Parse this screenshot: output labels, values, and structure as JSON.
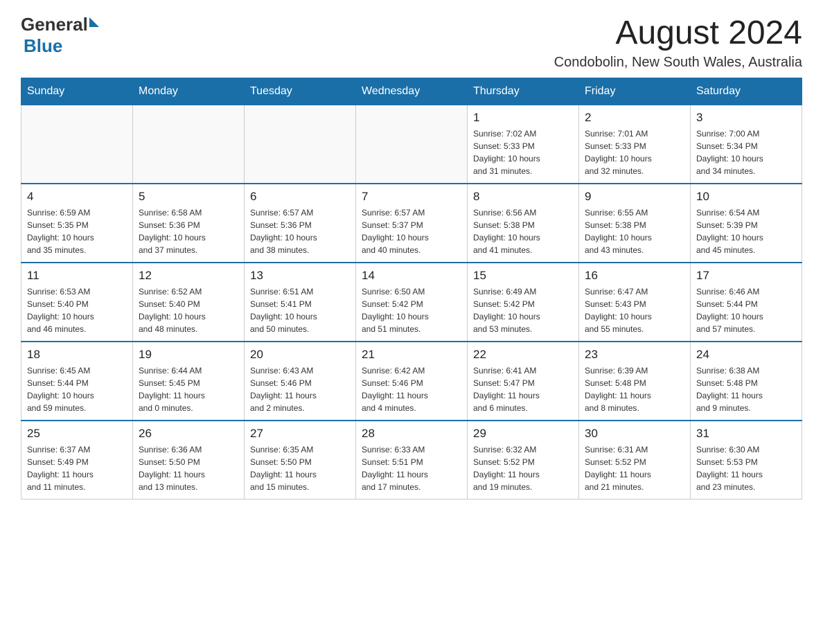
{
  "header": {
    "logo_general": "General",
    "logo_blue": "Blue",
    "title": "August 2024",
    "subtitle": "Condobolin, New South Wales, Australia"
  },
  "days_of_week": [
    "Sunday",
    "Monday",
    "Tuesday",
    "Wednesday",
    "Thursday",
    "Friday",
    "Saturday"
  ],
  "weeks": [
    {
      "days": [
        {
          "number": "",
          "info": ""
        },
        {
          "number": "",
          "info": ""
        },
        {
          "number": "",
          "info": ""
        },
        {
          "number": "",
          "info": ""
        },
        {
          "number": "1",
          "info": "Sunrise: 7:02 AM\nSunset: 5:33 PM\nDaylight: 10 hours\nand 31 minutes."
        },
        {
          "number": "2",
          "info": "Sunrise: 7:01 AM\nSunset: 5:33 PM\nDaylight: 10 hours\nand 32 minutes."
        },
        {
          "number": "3",
          "info": "Sunrise: 7:00 AM\nSunset: 5:34 PM\nDaylight: 10 hours\nand 34 minutes."
        }
      ]
    },
    {
      "days": [
        {
          "number": "4",
          "info": "Sunrise: 6:59 AM\nSunset: 5:35 PM\nDaylight: 10 hours\nand 35 minutes."
        },
        {
          "number": "5",
          "info": "Sunrise: 6:58 AM\nSunset: 5:36 PM\nDaylight: 10 hours\nand 37 minutes."
        },
        {
          "number": "6",
          "info": "Sunrise: 6:57 AM\nSunset: 5:36 PM\nDaylight: 10 hours\nand 38 minutes."
        },
        {
          "number": "7",
          "info": "Sunrise: 6:57 AM\nSunset: 5:37 PM\nDaylight: 10 hours\nand 40 minutes."
        },
        {
          "number": "8",
          "info": "Sunrise: 6:56 AM\nSunset: 5:38 PM\nDaylight: 10 hours\nand 41 minutes."
        },
        {
          "number": "9",
          "info": "Sunrise: 6:55 AM\nSunset: 5:38 PM\nDaylight: 10 hours\nand 43 minutes."
        },
        {
          "number": "10",
          "info": "Sunrise: 6:54 AM\nSunset: 5:39 PM\nDaylight: 10 hours\nand 45 minutes."
        }
      ]
    },
    {
      "days": [
        {
          "number": "11",
          "info": "Sunrise: 6:53 AM\nSunset: 5:40 PM\nDaylight: 10 hours\nand 46 minutes."
        },
        {
          "number": "12",
          "info": "Sunrise: 6:52 AM\nSunset: 5:40 PM\nDaylight: 10 hours\nand 48 minutes."
        },
        {
          "number": "13",
          "info": "Sunrise: 6:51 AM\nSunset: 5:41 PM\nDaylight: 10 hours\nand 50 minutes."
        },
        {
          "number": "14",
          "info": "Sunrise: 6:50 AM\nSunset: 5:42 PM\nDaylight: 10 hours\nand 51 minutes."
        },
        {
          "number": "15",
          "info": "Sunrise: 6:49 AM\nSunset: 5:42 PM\nDaylight: 10 hours\nand 53 minutes."
        },
        {
          "number": "16",
          "info": "Sunrise: 6:47 AM\nSunset: 5:43 PM\nDaylight: 10 hours\nand 55 minutes."
        },
        {
          "number": "17",
          "info": "Sunrise: 6:46 AM\nSunset: 5:44 PM\nDaylight: 10 hours\nand 57 minutes."
        }
      ]
    },
    {
      "days": [
        {
          "number": "18",
          "info": "Sunrise: 6:45 AM\nSunset: 5:44 PM\nDaylight: 10 hours\nand 59 minutes."
        },
        {
          "number": "19",
          "info": "Sunrise: 6:44 AM\nSunset: 5:45 PM\nDaylight: 11 hours\nand 0 minutes."
        },
        {
          "number": "20",
          "info": "Sunrise: 6:43 AM\nSunset: 5:46 PM\nDaylight: 11 hours\nand 2 minutes."
        },
        {
          "number": "21",
          "info": "Sunrise: 6:42 AM\nSunset: 5:46 PM\nDaylight: 11 hours\nand 4 minutes."
        },
        {
          "number": "22",
          "info": "Sunrise: 6:41 AM\nSunset: 5:47 PM\nDaylight: 11 hours\nand 6 minutes."
        },
        {
          "number": "23",
          "info": "Sunrise: 6:39 AM\nSunset: 5:48 PM\nDaylight: 11 hours\nand 8 minutes."
        },
        {
          "number": "24",
          "info": "Sunrise: 6:38 AM\nSunset: 5:48 PM\nDaylight: 11 hours\nand 9 minutes."
        }
      ]
    },
    {
      "days": [
        {
          "number": "25",
          "info": "Sunrise: 6:37 AM\nSunset: 5:49 PM\nDaylight: 11 hours\nand 11 minutes."
        },
        {
          "number": "26",
          "info": "Sunrise: 6:36 AM\nSunset: 5:50 PM\nDaylight: 11 hours\nand 13 minutes."
        },
        {
          "number": "27",
          "info": "Sunrise: 6:35 AM\nSunset: 5:50 PM\nDaylight: 11 hours\nand 15 minutes."
        },
        {
          "number": "28",
          "info": "Sunrise: 6:33 AM\nSunset: 5:51 PM\nDaylight: 11 hours\nand 17 minutes."
        },
        {
          "number": "29",
          "info": "Sunrise: 6:32 AM\nSunset: 5:52 PM\nDaylight: 11 hours\nand 19 minutes."
        },
        {
          "number": "30",
          "info": "Sunrise: 6:31 AM\nSunset: 5:52 PM\nDaylight: 11 hours\nand 21 minutes."
        },
        {
          "number": "31",
          "info": "Sunrise: 6:30 AM\nSunset: 5:53 PM\nDaylight: 11 hours\nand 23 minutes."
        }
      ]
    }
  ]
}
